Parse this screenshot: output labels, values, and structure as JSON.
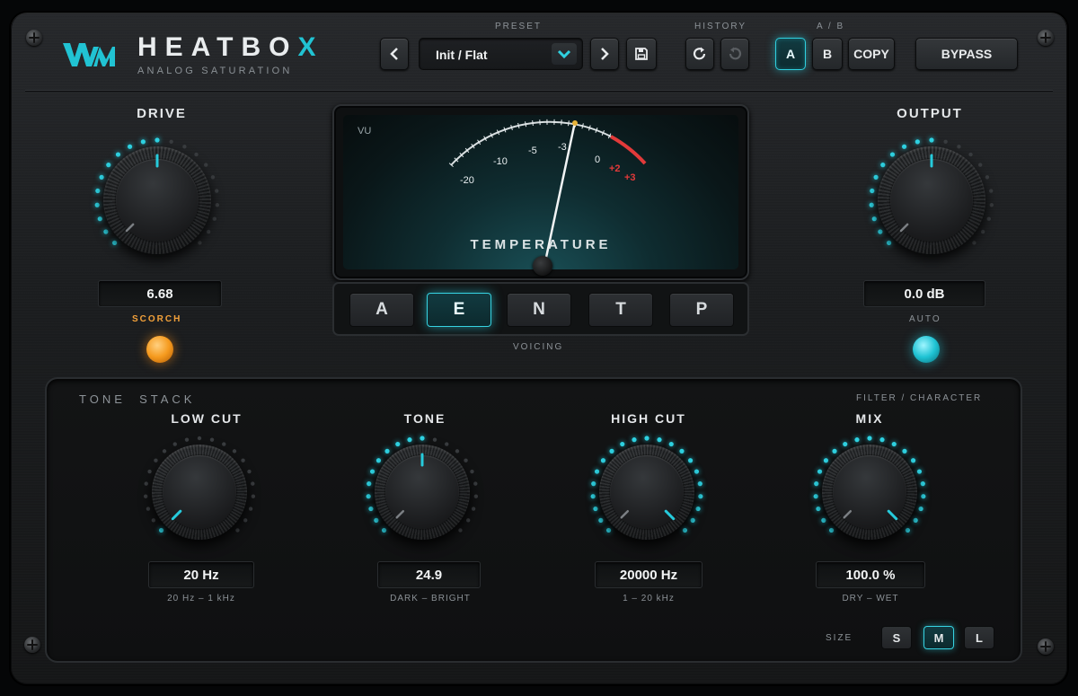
{
  "brand": {
    "name_main": "HEATBO",
    "name_accent": "X",
    "subtitle": "ANALOG SATURATION"
  },
  "header": {
    "preset_label": "PRESET",
    "preset_value": "Init / Flat",
    "history_label": "HISTORY",
    "ab_label": "A / B",
    "a_label": "A",
    "b_label": "B",
    "copy_label": "COPY",
    "bypass_label": "BYPASS",
    "active_slot": "A"
  },
  "drive": {
    "title": "DRIVE",
    "value": "6.68",
    "led_label": "SCORCH"
  },
  "output": {
    "title": "OUTPUT",
    "value": "0.0 dB",
    "led_label": "AUTO"
  },
  "meter": {
    "vu_label": "VU",
    "title": "TEMPERATURE",
    "scale": [
      "-20",
      "-10",
      "-5",
      "-3",
      "0",
      "+2",
      "+3"
    ]
  },
  "voicing": {
    "label": "VOICING",
    "options": [
      "A",
      "E",
      "N",
      "T",
      "P"
    ],
    "selected": "E"
  },
  "tone_stack": {
    "title": "TONE  STACK",
    "subtitle": "FILTER / CHARACTER",
    "knobs": [
      {
        "title": "LOW CUT",
        "value": "20 Hz",
        "range": "20 Hz – 1 kHz"
      },
      {
        "title": "TONE",
        "value": "24.9",
        "range": "DARK – BRIGHT"
      },
      {
        "title": "HIGH CUT",
        "value": "20000 Hz",
        "range": "1 – 20 kHz"
      },
      {
        "title": "MIX",
        "value": "100.0 %",
        "range": "DRY – WET"
      }
    ]
  },
  "size": {
    "label": "SIZE",
    "options": [
      "S",
      "M",
      "L"
    ],
    "selected": "M"
  },
  "colors": {
    "accent": "#21c3d3",
    "led_orange": "#f59a1e",
    "warn_red": "#e23a3a"
  }
}
